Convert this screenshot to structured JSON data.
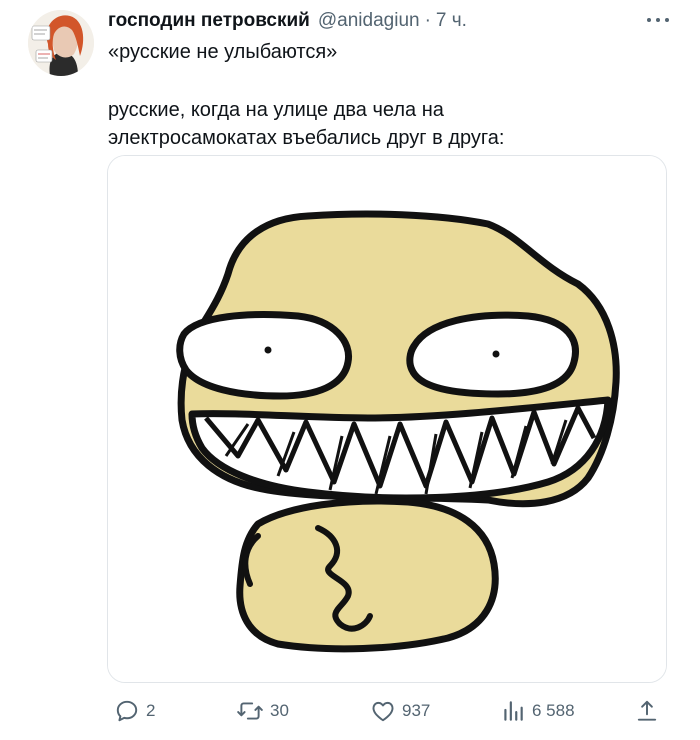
{
  "author": {
    "display_name": "господин петровский",
    "handle": "@anidagiun",
    "separator": "·",
    "time": "7 ч."
  },
  "tweet": {
    "lines": [
      "«русские не улыбаются»",
      "",
      "русские, когда на улице два чела на",
      "электросамокатах въебались друг в друга:"
    ]
  },
  "media": {
    "image": "grinning-face-drawing",
    "face_color": "#eadb9b",
    "outline_color": "#111111"
  },
  "actions": {
    "replies": "2",
    "retweets": "30",
    "likes": "937",
    "views": "6 588"
  },
  "icons": {
    "more": "more-icon",
    "reply": "reply-icon",
    "retweet": "retweet-icon",
    "like": "heart-icon",
    "views": "views-icon",
    "share": "share-icon"
  },
  "colors": {
    "text": "#0f1419",
    "secondary": "#536471",
    "border": "#e1e5e9"
  }
}
